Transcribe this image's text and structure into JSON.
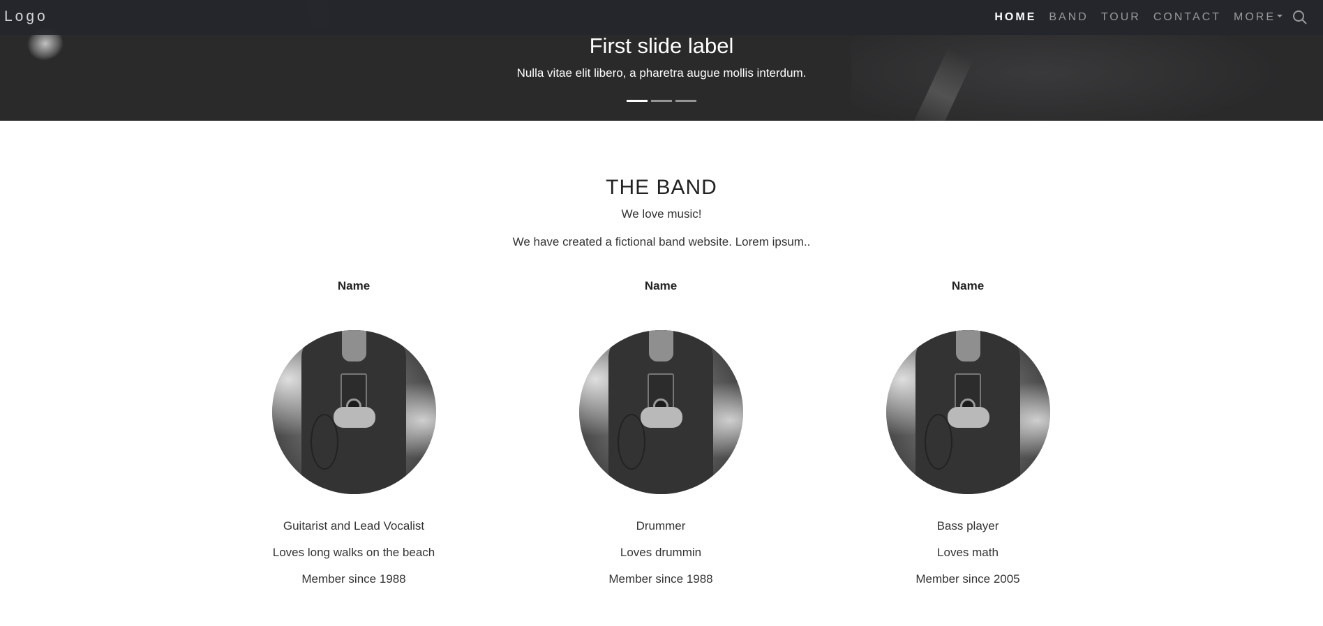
{
  "navbar": {
    "logo": "Logo",
    "items": [
      {
        "label": "HOME"
      },
      {
        "label": "BAND"
      },
      {
        "label": "TOUR"
      },
      {
        "label": "CONTACT"
      },
      {
        "label": "MORE"
      }
    ],
    "search_icon": "search-icon"
  },
  "carousel": {
    "title": "First slide label",
    "text": "Nulla vitae elit libero, a pharetra augue mollis interdum.",
    "active_index": 0
  },
  "band": {
    "title": "THE BAND",
    "tagline": "We love music!",
    "description": "We have created a fictional band website. Lorem ipsum..",
    "members": [
      {
        "name": "Name",
        "role": "Guitarist and Lead Vocalist",
        "hobby": "Loves long walks on the beach",
        "since": "Member since 1988"
      },
      {
        "name": "Name",
        "role": "Drummer",
        "hobby": "Loves drummin",
        "since": "Member since 1988"
      },
      {
        "name": "Name",
        "role": "Bass player",
        "hobby": "Loves math",
        "since": "Member since 2005"
      }
    ]
  },
  "colors": {
    "navbar_bg": "#24262c",
    "hero_bg": "#2a2a2b",
    "nav_active": "#ffffff",
    "nav_inactive": "#9a9a9a"
  }
}
